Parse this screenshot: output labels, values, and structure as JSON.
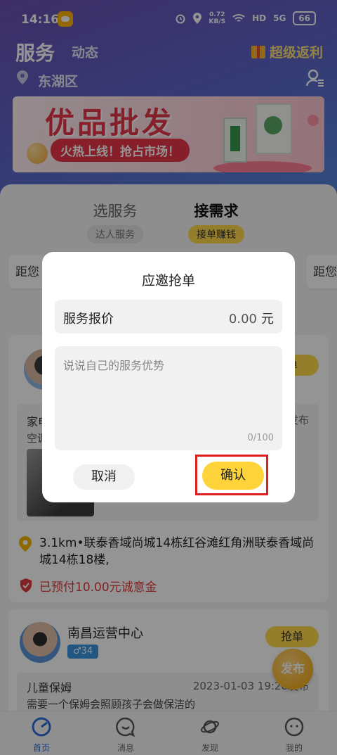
{
  "status_bar": {
    "time": "14:16",
    "net_speed_value": "0.72",
    "net_speed_unit": "KB/S",
    "hd": "HD",
    "signal": "5G",
    "battery": "66"
  },
  "header": {
    "title": "服务",
    "subtitle": "动态",
    "promo": "超级返利"
  },
  "location": {
    "city": "东湖区"
  },
  "banner": {
    "headline": "优品批发",
    "slogan": "火热上线！抢占市场！"
  },
  "tabs": [
    {
      "label": "选服务",
      "sub": "达人服务"
    },
    {
      "label": "接需求",
      "sub": "接单赚钱"
    }
  ],
  "category_cards": {
    "left": "距您",
    "right": "距您"
  },
  "card1": {
    "grab": "单",
    "service": "家电",
    "desc": "空调",
    "posted": "发布",
    "address": "3.1km•联泰香域尚城14栋红谷滩红角洲联泰香域尚城14栋18楼,",
    "paid": "已预付10.00元诚意金"
  },
  "card2": {
    "name": "南昌运营中心",
    "badge": "♂34",
    "grab": "抢单",
    "service": "儿童保姆",
    "posted": "2023-01-03 19:28发布",
    "desc": "需要一个保姆会照顾孩子会做保洁的"
  },
  "fab": {
    "label": "发布"
  },
  "bottom_nav": [
    {
      "label": "首页"
    },
    {
      "label": "消息"
    },
    {
      "label": "发现"
    },
    {
      "label": "我的"
    }
  ],
  "dialog": {
    "title": "应邀抢单",
    "price_label": "服务报价",
    "price_value": "0.00",
    "price_unit": "元",
    "advantage_placeholder": "说说自己的服务优势",
    "advantage_value": "",
    "counter": "0/100",
    "cancel": "取消",
    "confirm": "确认"
  },
  "colors": {
    "accent_yellow": "#ffd43b",
    "highlight_red": "#e01e1e",
    "nav_active": "#2e6fd9",
    "paid_red": "#e03a3a"
  }
}
